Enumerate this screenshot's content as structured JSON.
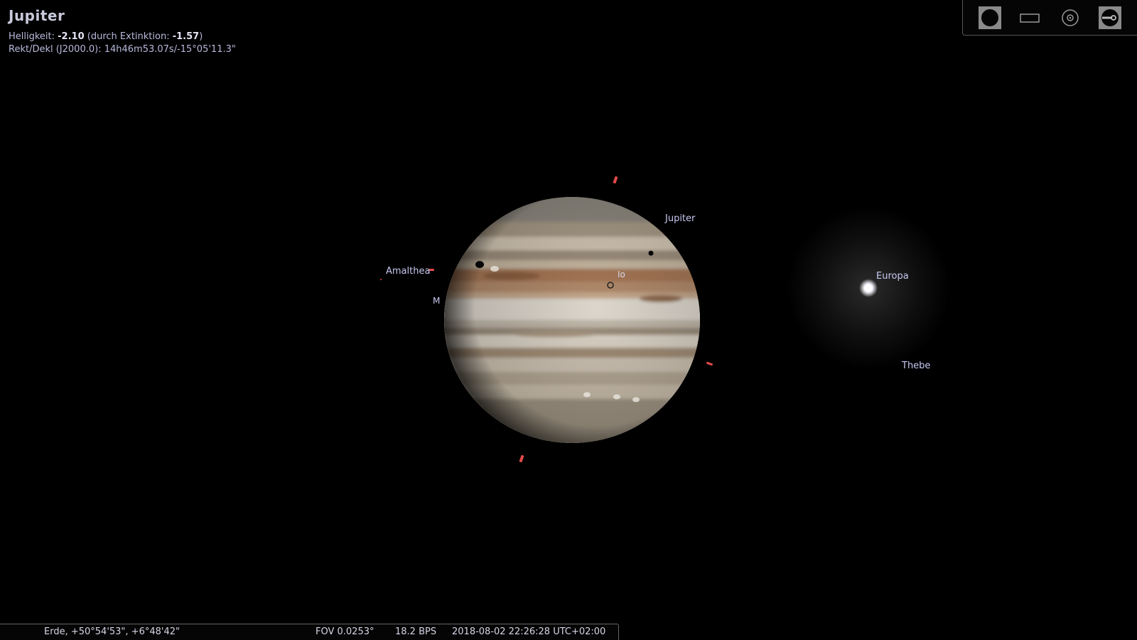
{
  "info": {
    "title": "Jupiter",
    "magnitude_label": "Helligkeit:",
    "magnitude_value": "-2.10",
    "extinction_label": "(durch Extinktion:",
    "extinction_value": "-1.57",
    "extinction_close": ")",
    "radec_label": "Rekt/Dekl (J2000.0):",
    "radec_value": "14h46m53.07s/-15°05'11.3\""
  },
  "toolbar": {
    "buttons": [
      {
        "name": "planet-view-icon"
      },
      {
        "name": "rectangle-ocular-icon"
      },
      {
        "name": "circle-ocular-icon"
      },
      {
        "name": "telescope-control-icon"
      }
    ]
  },
  "sky_labels": {
    "jupiter": "Jupiter",
    "europa": "Europa",
    "io": "Io",
    "amalthea": "Amalthea",
    "metis": "M",
    "thebe": "Thebe"
  },
  "status": {
    "location": "Erde, +50°54'53\", +6°48'42\"",
    "fov": "FOV 0.0253°",
    "fps": "18.2 BPS",
    "datetime": "2018-08-02 22:26:28 UTC+02:00"
  },
  "colors": {
    "background": "#000000",
    "label": "#c8c8f2",
    "marker": "#e24a4a"
  }
}
